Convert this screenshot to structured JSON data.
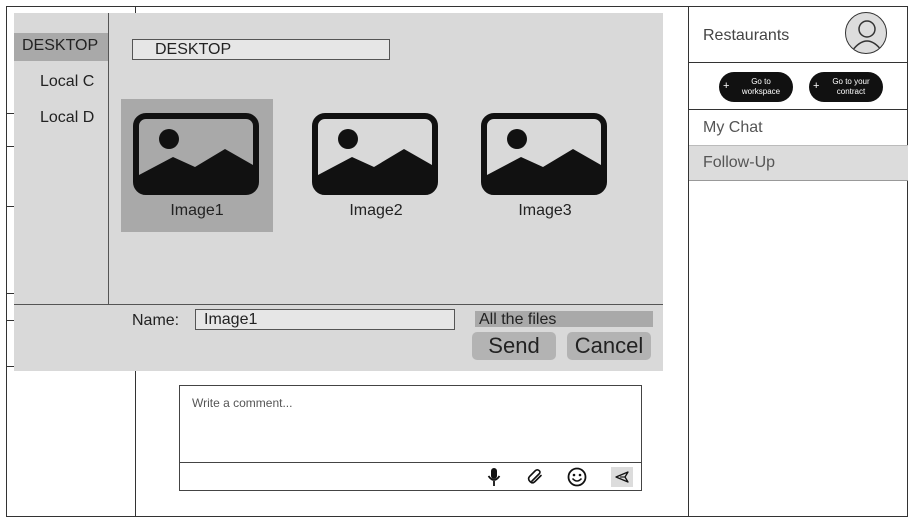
{
  "header": {
    "restaurants_label": "Restaurants",
    "workspace_button": "Go to workspace",
    "contract_button": "Go to your contract"
  },
  "right_menu": {
    "items": [
      {
        "label": "My Chat"
      },
      {
        "label": "Follow-Up"
      }
    ]
  },
  "comment": {
    "placeholder": "Write a comment..."
  },
  "file_dialog": {
    "sidebar": [
      {
        "label": "DESKTOP"
      },
      {
        "label": "Local C"
      },
      {
        "label": "Local D"
      }
    ],
    "path": "DESKTOP",
    "files": [
      {
        "name": "Image1"
      },
      {
        "name": "Image2"
      },
      {
        "name": "Image3"
      }
    ],
    "name_label": "Name:",
    "name_value": "Image1",
    "filter": "All the files",
    "send_label": "Send",
    "cancel_label": "Cancel"
  },
  "colors": {
    "dialog_bg": "#d9d9d9",
    "selected_bg": "#a9a9a9",
    "button_bg": "#b3b3b3"
  }
}
